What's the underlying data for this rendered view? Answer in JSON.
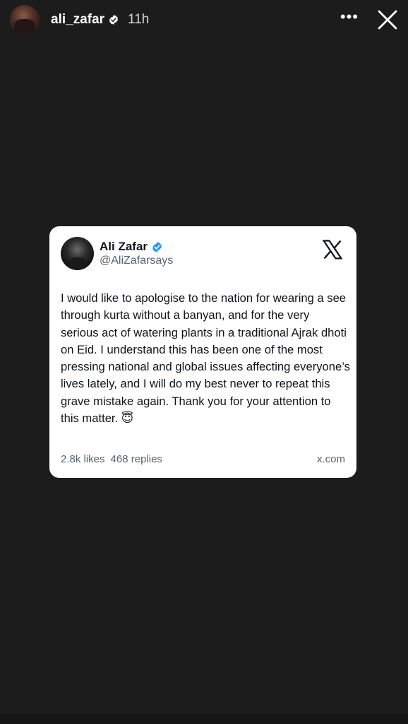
{
  "story": {
    "username": "ali_zafar",
    "time_ago": "11h",
    "more_label": "•••",
    "verified_icon": "verified-badge-icon",
    "close_icon": "close-icon",
    "colors": {
      "background": "#1c1c1c",
      "verified": "#1d9bf0"
    }
  },
  "tweet": {
    "name": "Ali Zafar",
    "handle": "@AliZafarsays",
    "text": "I would like to apologise to the nation for wearing a see through kurta without a banyan, and for the very serious act of watering plants in a traditional Ajrak dhoti on Eid. I understand this has been one of the most pressing national and global issues affecting everyone’s lives lately, and I will do my best never to repeat this grave mistake again. Thank you for your attention to this matter. 😇",
    "likes": "2.8k likes",
    "replies": "468 replies",
    "domain": "x.com",
    "logo_icon": "x-logo-icon"
  }
}
